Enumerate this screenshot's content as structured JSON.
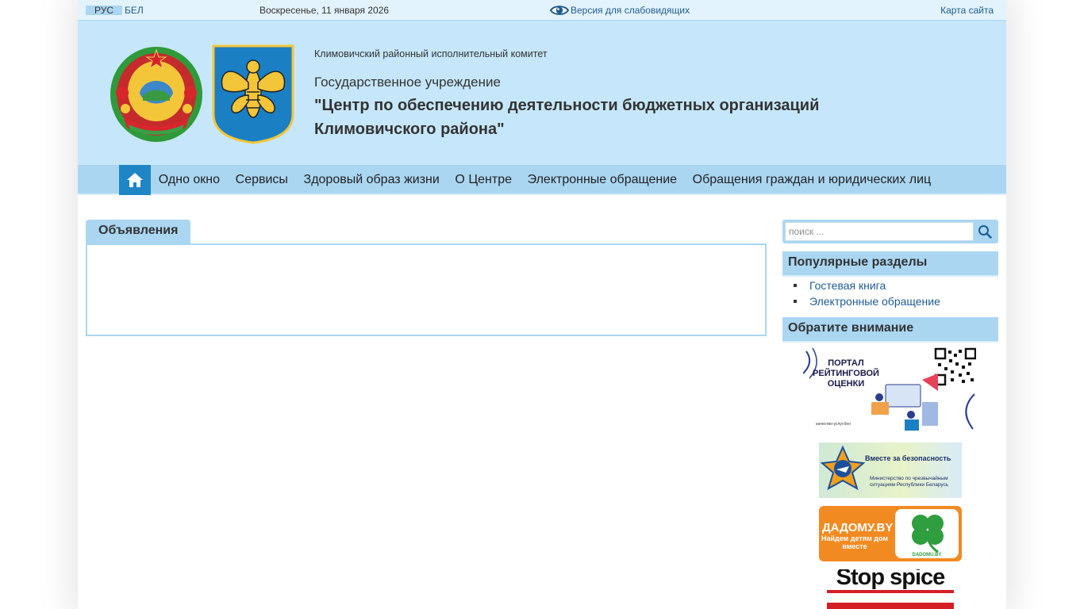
{
  "topbar": {
    "lang_ru": "РУС",
    "lang_be": "БЕЛ",
    "date": "Воскресенье, 11 января 2026",
    "low_vision": "Версия для слабовидящих",
    "sitemap": "Карта сайта"
  },
  "header": {
    "executive": "Климовичский районный исполнительный комитет",
    "institution": "Государственное учреждение",
    "centre_name": "\"Центр по обеспечению деятельности бюджетных организаций Климовичского района\""
  },
  "nav": {
    "items": [
      "Одно окно",
      "Сервисы",
      "Здоровый образ жизни",
      "О Центре",
      "Электронные обращение",
      "Обращения граждан и юридических лиц"
    ]
  },
  "main": {
    "announcements_tab": "Объявления"
  },
  "sidebar": {
    "search_placeholder": "поиск ...",
    "popular_title": "Популярные разделы",
    "popular_items": [
      "Гостевая книга",
      "Электронные обращение"
    ],
    "attention_title": "Обратите внимание",
    "banners": {
      "rating_line1": "ПОРТАЛ",
      "rating_line2": "РЕЙТИНГОВОЙ",
      "rating_line3": "ОЦЕНКИ",
      "rating_url": "качество-услуг.бел",
      "mchs_title": "Вместе за безопасность",
      "mchs_sub": "Министерство по чрезвычайным ситуациям Республики Беларусь",
      "dadomu_title": "ДАДОМУ.BY",
      "dadomu_sub": "Найдем детям дом вместе",
      "dadomu_logo": "DADOMU.BY",
      "stop_text": "Stop spice"
    }
  },
  "colors": {
    "topbar_bg": "#e3f3fd",
    "header_bg": "#c6e7fb",
    "nav_bg": "#aad6f2",
    "home_bg": "#1e86c5",
    "link": "#1e5c8f"
  }
}
